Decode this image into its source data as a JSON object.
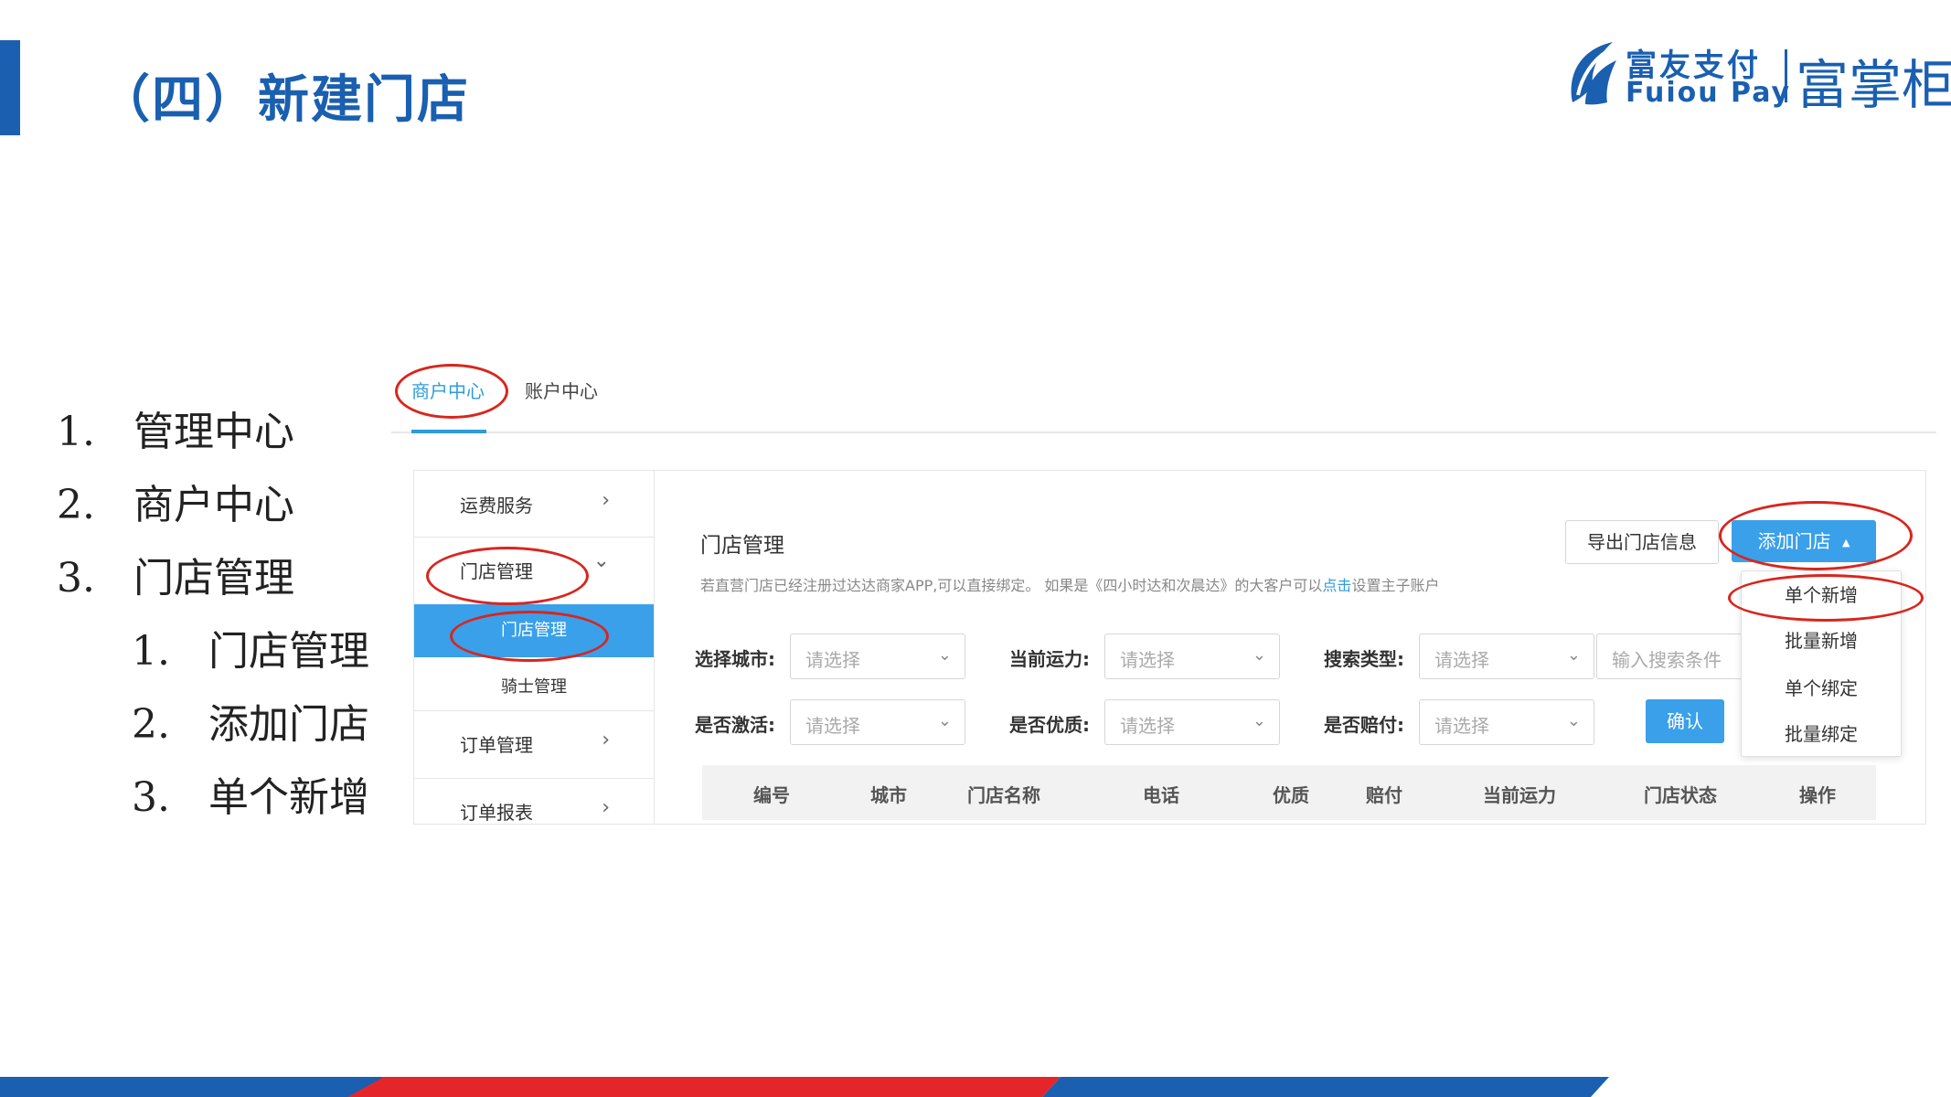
{
  "slide": {
    "title": "（四）新建门店",
    "logo": {
      "cn": "富友支付",
      "en": "Fuiou Pay",
      "brand": "富掌柜"
    },
    "outline": [
      {
        "num": "1.",
        "text": "管理中心"
      },
      {
        "num": "2.",
        "text": "商户中心"
      },
      {
        "num": "3.",
        "text": "门店管理"
      }
    ],
    "sub_outline": [
      {
        "num": "1.",
        "text": "门店管理"
      },
      {
        "num": "2.",
        "text": "添加门店"
      },
      {
        "num": "3.",
        "text": "单个新增"
      }
    ]
  },
  "tabs": {
    "merchant": "商户中心",
    "account": "账户中心"
  },
  "sidebar": {
    "items": [
      {
        "label": "运费服务",
        "chevron": "›"
      },
      {
        "label": "门店管理",
        "chevron": "⌄"
      },
      {
        "label": "订单管理",
        "chevron": "›"
      },
      {
        "label": "订单报表",
        "chevron": "›"
      }
    ],
    "sub_items": [
      {
        "label": "门店管理"
      },
      {
        "label": "骑士管理"
      }
    ]
  },
  "content": {
    "title": "门店管理",
    "notice_text": "若直营门店已经注册过达达商家APP,可以直接绑定。 如果是《四小时达和次晨达》的大客户可以",
    "notice_link": "点击",
    "notice_tail": "设置主子账户",
    "export_button": "导出门店信息",
    "add_button": "添加门店",
    "add_caret": "▲",
    "filters": {
      "city_label": "选择城市:",
      "capacity_label": "当前运力:",
      "search_type_label": "搜索类型:",
      "activated_label": "是否激活:",
      "quality_label": "是否优质:",
      "compensation_label": "是否赔付:",
      "placeholder": "请选择",
      "search_placeholder": "输入搜索条件",
      "arrow": "⌄"
    },
    "confirm_button": "确认",
    "table_headers": [
      "编号",
      "城市",
      "门店名称",
      "电话",
      "优质",
      "赔付",
      "当前运力",
      "门店状态",
      "操作"
    ]
  },
  "dropdown": {
    "items": [
      "单个新增",
      "批量新增",
      "单个绑定",
      "批量绑定"
    ]
  },
  "colors": {
    "brand_blue": "#1a5fb0",
    "primary": "#3aa0ea",
    "annotation_red": "#d9251d",
    "stripe_red": "#e4262b"
  }
}
